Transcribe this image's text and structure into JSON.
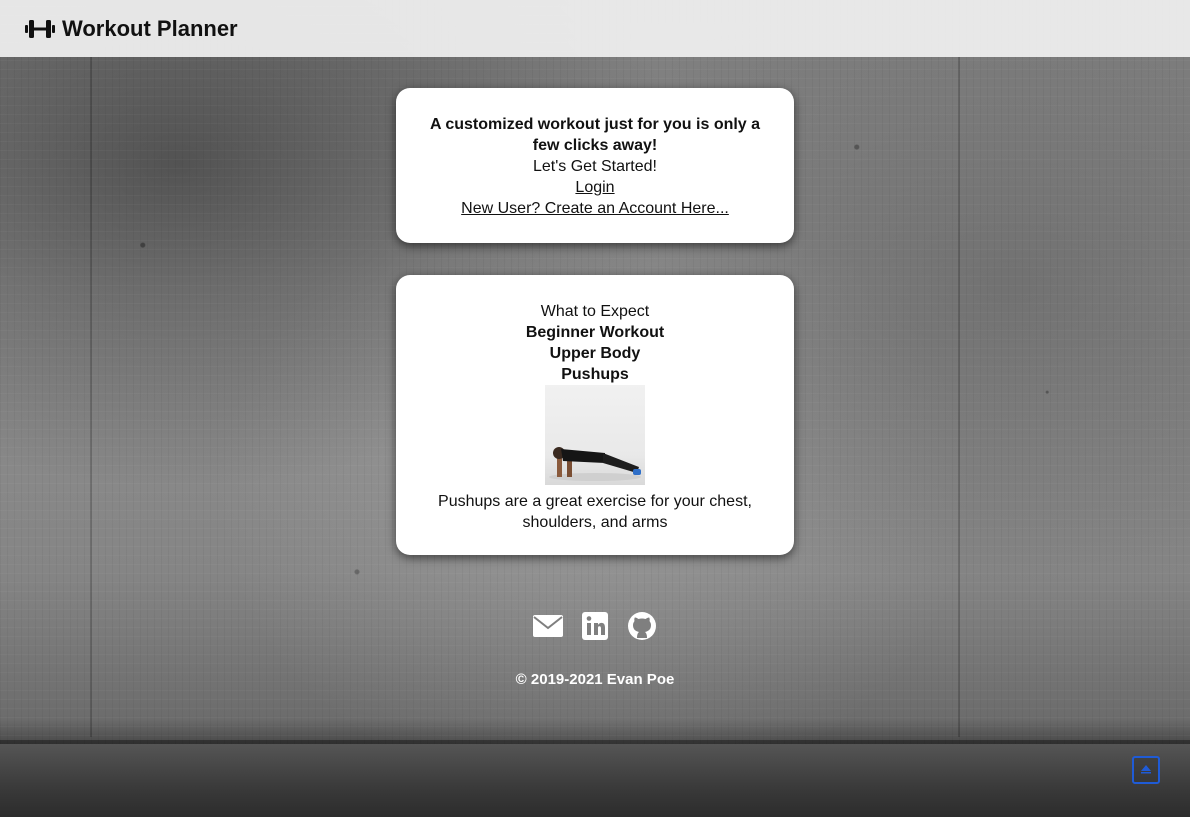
{
  "navbar": {
    "brand_title": "Workout Planner",
    "brand_icon": "dumbbell-icon"
  },
  "intro_card": {
    "headline": "A customized workout just for you is only a few clicks away!",
    "subheading": "Let's Get Started!",
    "login_link": "Login",
    "signup_link": "New User? Create an Account Here..."
  },
  "preview_card": {
    "intro": "What to Expect",
    "workout_level": "Beginner Workout",
    "body_area": "Upper Body",
    "exercise_name": "Pushups",
    "exercise_image": "pushup-photo",
    "exercise_description": "Pushups are a great exercise for your chest, shoulders, and arms"
  },
  "footer": {
    "social_icons": [
      "envelope-icon",
      "linkedin-icon",
      "github-icon"
    ],
    "copyright": "© 2019-2021 Evan Poe",
    "back_to_top_icon": "arrow-up-icon"
  },
  "colors": {
    "navbar_bg": "#f0f0f0",
    "card_bg": "#ffffff",
    "text": "#111111",
    "back_to_top_border": "#1f5bd6"
  }
}
